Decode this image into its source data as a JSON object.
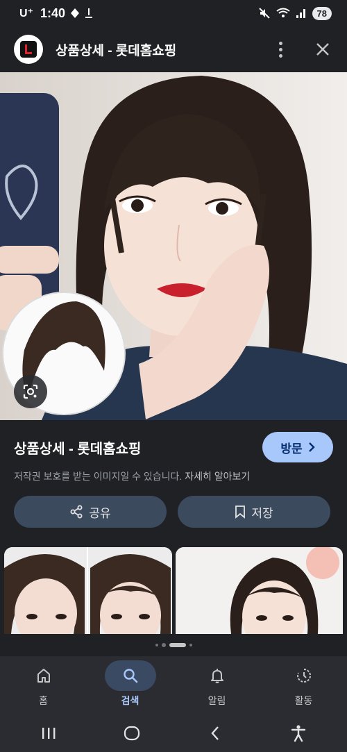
{
  "status_bar": {
    "carrier": "U⁺",
    "time": "1:40",
    "battery": "78"
  },
  "header": {
    "title": "상품상세 - 롯데홈쇼핑"
  },
  "result": {
    "title": "상품상세 - 롯데홈쇼핑",
    "visit_label": "방문",
    "copyright_text": "저작권 보호를 받는 이미지일 수 있습니다.",
    "learn_more": "자세히 알아보기"
  },
  "actions": {
    "share_label": "공유",
    "save_label": "저장"
  },
  "bottom_nav": {
    "items": [
      {
        "label": "홈",
        "icon": "home-icon",
        "active": false
      },
      {
        "label": "검색",
        "icon": "search-icon",
        "active": true
      },
      {
        "label": "알림",
        "icon": "bell-icon",
        "active": false
      },
      {
        "label": "활동",
        "icon": "history-icon",
        "active": false
      }
    ]
  },
  "colors": {
    "background": "#1f2125",
    "accent": "#a8c7fa",
    "button_bg": "#3c4a5e",
    "nav_bg": "#2a2c31"
  }
}
